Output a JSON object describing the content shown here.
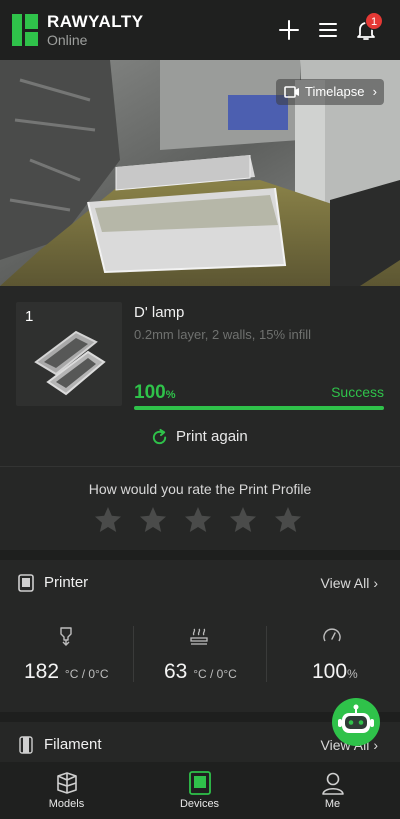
{
  "header": {
    "brand": "RAWYALTY",
    "status": "Online",
    "notification_count": "1",
    "icons": [
      "logo-icon",
      "plus-icon",
      "menu-icon",
      "bell-icon"
    ]
  },
  "camera": {
    "timelapse_label": "Timelapse",
    "chevron": "›"
  },
  "job": {
    "plate_number": "1",
    "name": "D' lamp",
    "details": "0.2mm layer, 2 walls, 15% infill",
    "progress_value": "100",
    "progress_unit": "%",
    "progress_fraction": 1.0,
    "result": "Success",
    "print_again_label": "Print again",
    "rating_question": "How would you rate the Print Profile",
    "stars_total": 5,
    "stars_selected": 0
  },
  "printer": {
    "title": "Printer",
    "view_all": "View All",
    "nozzle": {
      "value": "182",
      "unit": "°C / 0°C"
    },
    "bed": {
      "value": "63",
      "unit": "°C / 0°C"
    },
    "fan": {
      "value": "100",
      "unit": "%"
    }
  },
  "filament": {
    "title": "Filament",
    "view_all": "View All"
  },
  "nav": {
    "items": [
      {
        "label": "Models"
      },
      {
        "label": "Devices"
      },
      {
        "label": "Me"
      }
    ],
    "active": "Devices"
  },
  "colors": {
    "accent": "#2fc24a",
    "background": "#1e1f1e",
    "card": "#262726",
    "badge": "#e53935"
  }
}
